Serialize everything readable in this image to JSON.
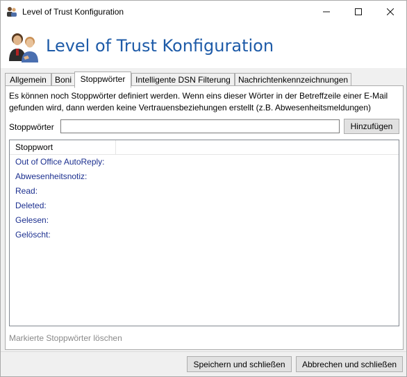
{
  "window": {
    "title": "Level of Trust Konfiguration"
  },
  "header": {
    "title": "Level of Trust Konfiguration",
    "icon": "users-icon"
  },
  "tabs": [
    {
      "label": "Allgemein",
      "active": false
    },
    {
      "label": "Boni",
      "active": false
    },
    {
      "label": "Stoppwörter",
      "active": true
    },
    {
      "label": "Intelligente DSN Filterung",
      "active": false
    },
    {
      "label": "Nachrichtenkennzeichnungen",
      "active": false
    }
  ],
  "stopwords": {
    "info_line1": "Es können noch Stoppwörter definiert werden. Wenn eins dieser Wörter in der Betreffzeile einer E-Mail",
    "info_line2": "gefunden wird, dann werden keine Vertrauensbeziehungen erstellt (z.B. Abwesenheitsmeldungen)",
    "field_label": "Stoppwörter",
    "input_value": "",
    "add_button": "Hinzufügen",
    "column_header": "Stoppwort",
    "items": [
      "Out of Office AutoReply:",
      "Abwesenheitsnotiz:",
      "Read:",
      "Deleted:",
      "Gelesen:",
      "Gelöscht:"
    ],
    "delete_label": "Markierte Stoppwörter löschen"
  },
  "footer": {
    "save_label": "Speichern und schließen",
    "cancel_label": "Abbrechen und schließen"
  },
  "colors": {
    "header_title": "#1e5ba8",
    "list_text": "#1b2f8f",
    "disabled_text": "#8a8a8a"
  }
}
